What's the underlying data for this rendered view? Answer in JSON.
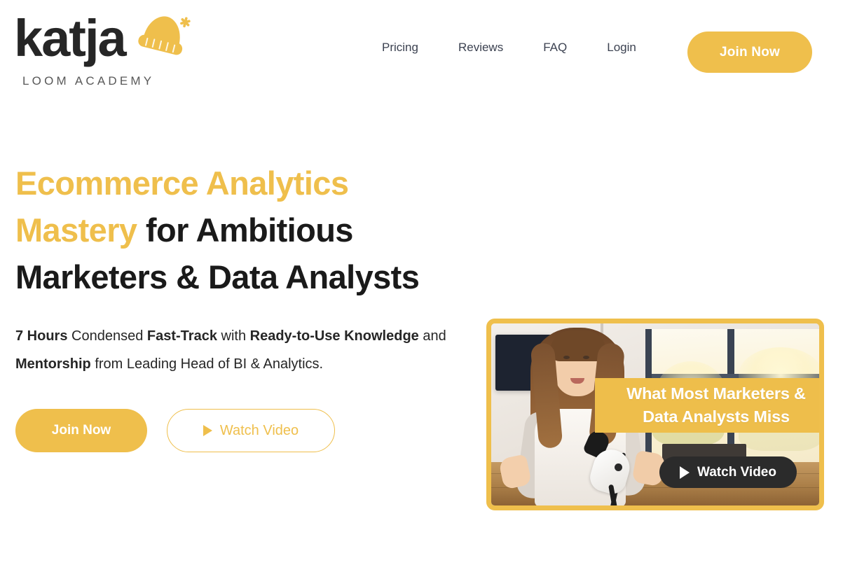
{
  "brand": {
    "logo_word": "katja",
    "logo_tagline": "LOOM ACADEMY",
    "accent_color": "#EFBF4C",
    "dark_color": "#1A1A1A",
    "beanie_icon": "beanie-hat-icon"
  },
  "nav": {
    "links": [
      {
        "label": "Pricing"
      },
      {
        "label": "Reviews"
      },
      {
        "label": "FAQ"
      },
      {
        "label": "Login"
      }
    ],
    "cta_label": "Join Now"
  },
  "hero": {
    "headline": {
      "accent_part": "Ecommerce Analytics Mastery",
      "rest_part": " for Ambitious Marketers & Data Analysts"
    },
    "subhead": {
      "bold_1": "7 Hours",
      "text_1": " Condensed ",
      "bold_2": "Fast-Track",
      "text_2": " with ",
      "bold_3": "Ready-to-Use Knowledge",
      "text_3": " and ",
      "bold_4": "Mentorship",
      "text_4": " from Leading Head of BI & Analytics."
    },
    "cta_primary": "Join Now",
    "cta_secondary": "Watch Video",
    "play_icon": "play-triangle-icon"
  },
  "video_card": {
    "banner_line_1": "What Most Marketers &",
    "banner_line_2": "Data Analysts Miss",
    "watch_label": "Watch Video",
    "play_icon": "play-triangle-icon",
    "banner_color": "#EEBE4B",
    "pill_color": "#2B2B2B",
    "border_color": "#EFBF4C",
    "thumbnail_description": "Woman with microphone in bright room"
  }
}
